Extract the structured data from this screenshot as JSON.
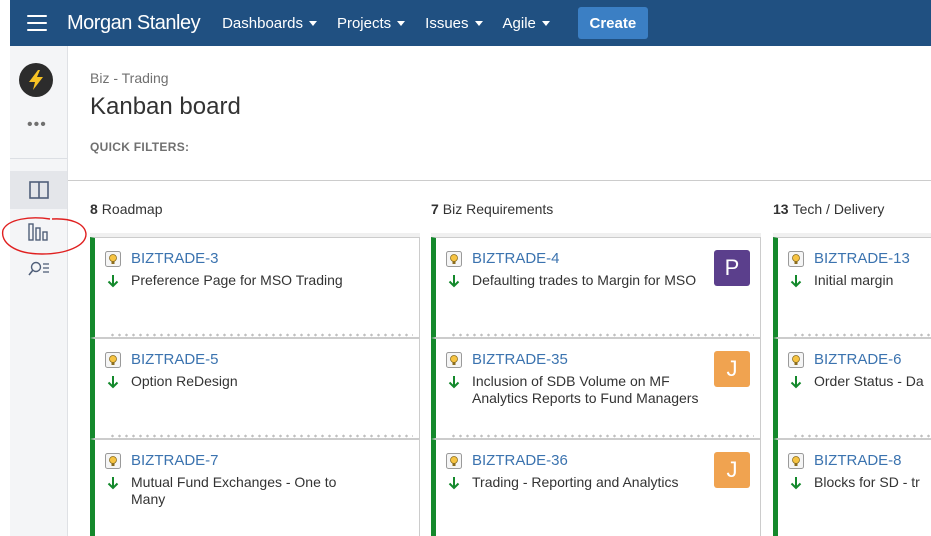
{
  "nav": {
    "brand": "Morgan Stanley",
    "items": [
      {
        "label": "Dashboards"
      },
      {
        "label": "Projects"
      },
      {
        "label": "Issues"
      },
      {
        "label": "Agile"
      }
    ],
    "create_label": "Create",
    "colors": {
      "bar": "#205081",
      "create": "#3b7fc4"
    }
  },
  "sidebar": {
    "more_label": "•••",
    "items": [
      "lightning-logo",
      "board-icon",
      "reports-icon",
      "search-filter-icon"
    ]
  },
  "header": {
    "breadcrumb": "Biz - Trading",
    "title": "Kanban board",
    "quick_filters_label": "QUICK FILTERS:"
  },
  "columns": [
    {
      "count": "8",
      "name": "Roadmap",
      "cards": [
        {
          "key": "BIZTRADE-3",
          "summary": "Preference Page for MSO Trading",
          "avatar": ""
        },
        {
          "key": "BIZTRADE-5",
          "summary": "Option ReDesign",
          "avatar": ""
        },
        {
          "key": "BIZTRADE-7",
          "summary": "Mutual Fund Exchanges - One to Many",
          "avatar": ""
        }
      ]
    },
    {
      "count": "7",
      "name": "Biz Requirements",
      "cards": [
        {
          "key": "BIZTRADE-4",
          "summary": "Defaulting trades to Margin for MSO",
          "avatar": "P"
        },
        {
          "key": "BIZTRADE-35",
          "summary": "Inclusion of SDB Volume on MF Analytics Reports to Fund Managers",
          "avatar": "J"
        },
        {
          "key": "BIZTRADE-36",
          "summary": "Trading - Reporting and Analytics",
          "avatar": "J"
        }
      ]
    },
    {
      "count": "13",
      "name": "Tech / Delivery",
      "cards": [
        {
          "key": "BIZTRADE-13",
          "summary": "Initial margin",
          "avatar": ""
        },
        {
          "key": "BIZTRADE-6",
          "summary": "Order Status - Da",
          "avatar": ""
        },
        {
          "key": "BIZTRADE-8",
          "summary": "Blocks for SD - tr",
          "avatar": ""
        }
      ]
    }
  ],
  "card_icons": {
    "type": "idea-bulb-icon",
    "priority": "priority-low-arrow-icon"
  },
  "colors": {
    "card_border": "#14892c",
    "key_link": "#3b73af",
    "avatar_p": "#5b3f8c",
    "avatar_j": "#f0a350",
    "annotation": "#e02020"
  }
}
